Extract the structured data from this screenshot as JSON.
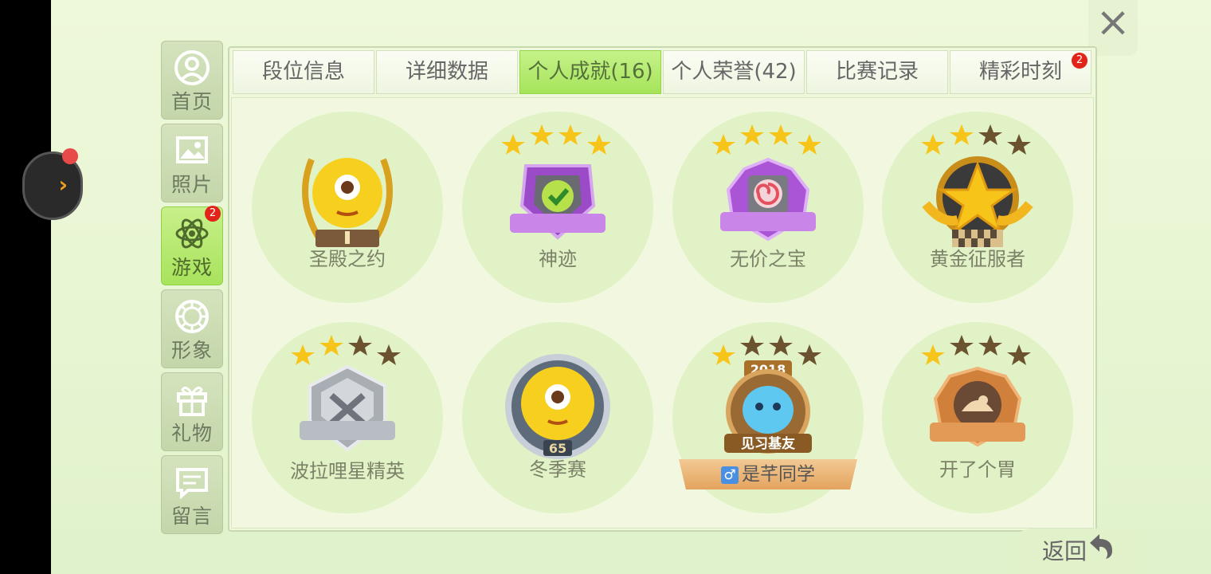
{
  "sidebar": {
    "items": [
      {
        "label": "首页",
        "icon": "home-icon",
        "active": false
      },
      {
        "label": "照片",
        "icon": "photo-icon",
        "active": false
      },
      {
        "label": "游戏",
        "icon": "atom-icon",
        "active": true,
        "badge": "2"
      },
      {
        "label": "形象",
        "icon": "avatar-icon",
        "active": false
      },
      {
        "label": "礼物",
        "icon": "gift-icon",
        "active": false
      },
      {
        "label": "留言",
        "icon": "message-icon",
        "active": false
      }
    ]
  },
  "tabs": [
    {
      "label": "段位信息",
      "active": false
    },
    {
      "label": "详细数据",
      "active": false
    },
    {
      "label": "个人成就(16)",
      "active": true
    },
    {
      "label": "个人荣誉(42)",
      "active": false
    },
    {
      "label": "比赛记录",
      "active": false
    },
    {
      "label": "精彩时刻",
      "active": false,
      "badge": "2"
    }
  ],
  "achievements": [
    {
      "name": "圣殿之约",
      "stars": 0,
      "emblem": "monster-laurel-badge-icon"
    },
    {
      "name": "神迹",
      "stars": 4,
      "emblem": "purple-shield-check-icon"
    },
    {
      "name": "无价之宝",
      "stars": 4,
      "emblem": "purple-candy-badge-icon"
    },
    {
      "name": "黄金征服者",
      "stars": 2,
      "emblem": "gold-star-badge-icon"
    },
    {
      "name": "波拉哩星精英",
      "stars": 2,
      "emblem": "silver-crest-badge-icon"
    },
    {
      "name": "冬季赛",
      "stars": 0,
      "emblem": "monster-silver-ring-badge-icon",
      "level": "65"
    },
    {
      "name": "见习基友",
      "stars": 1,
      "emblem": "blue-blob-2018-badge-icon",
      "year": "2018",
      "ribbon": "是芊同学",
      "ribbon_icon": "♂"
    },
    {
      "name": "开了个胃",
      "stars": 1,
      "emblem": "bronze-badge-icon"
    }
  ],
  "close_icon": "×",
  "back": {
    "label": "返回",
    "icon": "back-arrow-icon"
  },
  "colors": {
    "active_green": "#a8e35c",
    "badge_red": "#e2231a",
    "star_gold": "#f7c51a",
    "star_dark": "#6b5330"
  }
}
